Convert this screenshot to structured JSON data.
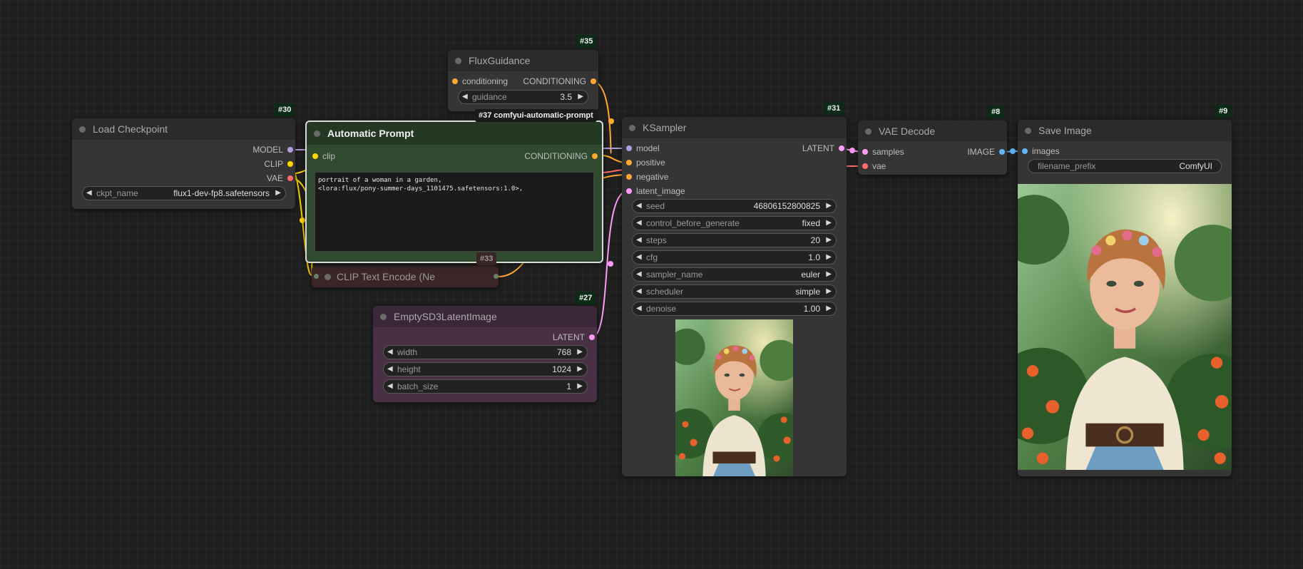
{
  "colors": {
    "canvas": "#1f1f1f",
    "node_body": "#353535",
    "node_title": "#2b2b2b",
    "green_node": "#2f4a2f",
    "purple_node": "#4a3045",
    "red_node": "#3a2626",
    "model": "#b39ddb",
    "clip": "#ffd500",
    "vae": "#ff6e6e",
    "conditioning": "#ffa931",
    "latent": "#ff9cf9",
    "image": "#64b5f6"
  },
  "nodes": {
    "load_checkpoint": {
      "id": "#30",
      "title": "Load Checkpoint",
      "outputs": [
        "MODEL",
        "CLIP",
        "VAE"
      ],
      "widgets": [
        {
          "name": "ckpt_name",
          "value": "flux1-dev-fp8.safetensors"
        }
      ]
    },
    "flux_guidance": {
      "id": "#35",
      "title": "FluxGuidance",
      "input": "conditioning",
      "output": "CONDITIONING",
      "widgets": [
        {
          "name": "guidance",
          "value": "3.5"
        }
      ]
    },
    "automatic_prompt": {
      "id": "#37 comfyui-automatic-prompt",
      "title": "Automatic Prompt",
      "input": "clip",
      "output": "CONDITIONING",
      "text_line1": "portrait of a woman in a garden,",
      "text_line2": "<lora:flux/pony-summer-days_1101475.safetensors:1.0>,"
    },
    "clip_text_encode": {
      "id": "#33",
      "title": "CLIP Text Encode (Ne"
    },
    "empty_latent": {
      "id": "#27",
      "title": "EmptySD3LatentImage",
      "output": "LATENT",
      "widgets": [
        {
          "name": "width",
          "value": "768"
        },
        {
          "name": "height",
          "value": "1024"
        },
        {
          "name": "batch_size",
          "value": "1"
        }
      ]
    },
    "ksampler": {
      "id": "#31",
      "title": "KSampler",
      "inputs": [
        "model",
        "positive",
        "negative",
        "latent_image"
      ],
      "output": "LATENT",
      "widgets": [
        {
          "name": "seed",
          "value": "46806152800825"
        },
        {
          "name": "control_before_generate",
          "value": "fixed"
        },
        {
          "name": "steps",
          "value": "20"
        },
        {
          "name": "cfg",
          "value": "1.0"
        },
        {
          "name": "sampler_name",
          "value": "euler"
        },
        {
          "name": "scheduler",
          "value": "simple"
        },
        {
          "name": "denoise",
          "value": "1.00"
        }
      ]
    },
    "vae_decode": {
      "id": "#8",
      "title": "VAE Decode",
      "inputs": [
        "samples",
        "vae"
      ],
      "output": "IMAGE"
    },
    "save_image": {
      "id": "#9",
      "title": "Save Image",
      "input": "images",
      "widgets": [
        {
          "name": "filename_prefix",
          "value": "ComfyUI"
        }
      ]
    }
  }
}
